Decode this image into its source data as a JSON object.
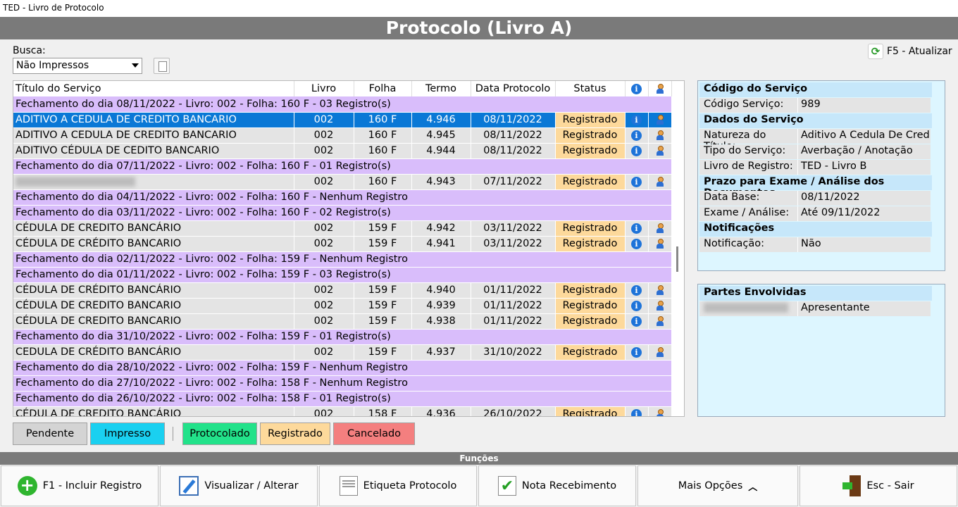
{
  "window_title": "TED - Livro de Protocolo",
  "banner_title": "Protocolo (Livro A)",
  "search": {
    "label": "Busca:",
    "selected": "Não Impressos"
  },
  "refresh_label": "F5 - Atualizar",
  "table": {
    "headers": [
      "Título do Serviço",
      "Livro",
      "Folha",
      "Termo",
      "Data Protocolo",
      "Status"
    ],
    "rows": [
      {
        "type": "group",
        "text": "Fechamento do dia 08/11/2022 - Livro: 002 - Folha: 160 F - 03 Registro(s)"
      },
      {
        "type": "data",
        "selected": true,
        "titulo": "ADITIVO A CEDULA DE CREDITO BANCARIO",
        "livro": "002",
        "folha": "160 F",
        "termo": "4.946",
        "data": "08/11/2022",
        "status": "Registrado"
      },
      {
        "type": "data",
        "titulo": "ADITIVO A CEDULA DE CREDITO BANCARIO",
        "livro": "002",
        "folha": "160 F",
        "termo": "4.945",
        "data": "08/11/2022",
        "status": "Registrado"
      },
      {
        "type": "data",
        "titulo": "ADITIVO CÉDULA DE CEDITO BANCARIO",
        "livro": "002",
        "folha": "160 F",
        "termo": "4.944",
        "data": "08/11/2022",
        "status": "Registrado"
      },
      {
        "type": "group",
        "text": "Fechamento do dia 07/11/2022 - Livro: 002 - Folha: 160 F - 01 Registro(s)"
      },
      {
        "type": "data",
        "blurred": true,
        "titulo": "",
        "livro": "002",
        "folha": "160 F",
        "termo": "4.943",
        "data": "07/11/2022",
        "status": "Registrado"
      },
      {
        "type": "group",
        "text": "Fechamento do dia 04/11/2022 - Livro: 002 - Folha: 160 F - Nenhum Registro"
      },
      {
        "type": "group",
        "text": "Fechamento do dia 03/11/2022 - Livro: 002 - Folha: 160 F - 02 Registro(s)"
      },
      {
        "type": "data",
        "titulo": "CÉDULA DE CREDITO BANCÁRIO",
        "livro": "002",
        "folha": "159 F",
        "termo": "4.942",
        "data": "03/11/2022",
        "status": "Registrado"
      },
      {
        "type": "data",
        "titulo": "CÉDULA DE CRÉDITO BANCARIO",
        "livro": "002",
        "folha": "159 F",
        "termo": "4.941",
        "data": "03/11/2022",
        "status": "Registrado"
      },
      {
        "type": "group",
        "text": "Fechamento do dia 02/11/2022 - Livro: 002 - Folha: 159 F - Nenhum Registro"
      },
      {
        "type": "group",
        "text": "Fechamento do dia 01/11/2022 - Livro: 002 - Folha: 159 F - 03 Registro(s)"
      },
      {
        "type": "data",
        "titulo": "CÉDULA DE CRÉDITO BANCÁRIO",
        "livro": "002",
        "folha": "159 F",
        "termo": "4.940",
        "data": "01/11/2022",
        "status": "Registrado"
      },
      {
        "type": "data",
        "titulo": "CÉDULA DE CREDITO BANCARIO",
        "livro": "002",
        "folha": "159 F",
        "termo": "4.939",
        "data": "01/11/2022",
        "status": "Registrado"
      },
      {
        "type": "data",
        "titulo": "CÉDULA DE CREDITO BANCARIO",
        "livro": "002",
        "folha": "159 F",
        "termo": "4.938",
        "data": "01/11/2022",
        "status": "Registrado"
      },
      {
        "type": "group",
        "text": "Fechamento do dia 31/10/2022 - Livro: 002 - Folha: 159 F - 01 Registro(s)"
      },
      {
        "type": "data",
        "titulo": "CEDULA DE CRÉDITO BANCÁRIO",
        "livro": "002",
        "folha": "159 F",
        "termo": "4.937",
        "data": "31/10/2022",
        "status": "Registrado"
      },
      {
        "type": "group",
        "text": "Fechamento do dia 28/10/2022 - Livro: 002 - Folha: 159 F - Nenhum Registro"
      },
      {
        "type": "group",
        "text": "Fechamento do dia 27/10/2022 - Livro: 002 - Folha: 158 F - Nenhum Registro"
      },
      {
        "type": "group",
        "text": "Fechamento do dia 26/10/2022 - Livro: 002 - Folha: 158 F - 01 Registro(s)"
      },
      {
        "type": "data",
        "titulo": "CÉDULA DE CREDITO BANCÁRIO",
        "livro": "002",
        "folha": "158 F",
        "termo": "4.936",
        "data": "26/10/2022",
        "status": "Registrado"
      }
    ]
  },
  "legend": [
    {
      "label": "Pendente",
      "color": "#d4d4d4"
    },
    {
      "label": "Impresso",
      "color": "#1ad0f0"
    },
    {
      "label": "Protocolado",
      "color": "#22e28a"
    },
    {
      "label": "Registrado",
      "color": "#fdd99b"
    },
    {
      "label": "Cancelado",
      "color": "#f47f7f"
    }
  ],
  "details": {
    "codigo_header": "Código do Serviço",
    "codigo_label": "Código Serviço:",
    "codigo_value": "989",
    "dados_header": "Dados do Serviço",
    "natureza_label": "Natureza do Título:",
    "natureza_value": "Aditivo A Cedula De Credit...",
    "tipo_label": "Tipo do Serviço:",
    "tipo_value": "Averbação / Anotação",
    "livro_label": "Livro de Registro:",
    "livro_value": "TED - Livro B",
    "prazo_header": "Prazo para Exame / Análise dos Documentos",
    "database_label": "Data Base:",
    "database_value": "08/11/2022",
    "exame_label": "Exame / Análise:",
    "exame_value": "Até 09/11/2022",
    "notif_header": "Notificações",
    "notif_label": "Notificação:",
    "notif_value": "Não"
  },
  "partes": {
    "header": "Partes Envolvidas",
    "role": "Apresentante"
  },
  "functions_label": "Funções",
  "buttons": {
    "incluir": "F1 - Incluir Registro",
    "visualizar": "Visualizar / Alterar",
    "etiqueta": "Etiqueta Protocolo",
    "nota": "Nota Recebimento",
    "mais": "Mais Opções",
    "sair": "Esc - Sair"
  }
}
